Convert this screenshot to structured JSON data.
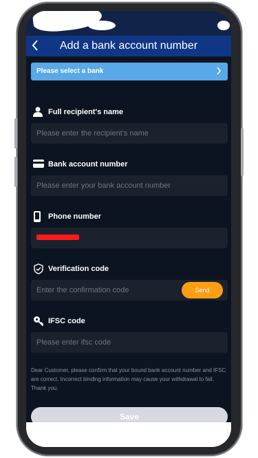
{
  "header": {
    "title": "Add a bank account number"
  },
  "bank_select": {
    "label": "Please select a bank"
  },
  "fields": {
    "name": {
      "label": "Full recipient's name",
      "placeholder": "Please enter the recipient's name"
    },
    "account": {
      "label": "Bank account number",
      "placeholder": "Please enter your bank account number"
    },
    "phone": {
      "label": "Phone number"
    },
    "verification": {
      "label": "Verification code",
      "placeholder": "Enter the confirmation code",
      "send_label": "Send"
    },
    "ifsc": {
      "label": "IFSC code",
      "placeholder": "Please enter ifsc code"
    }
  },
  "notice": "Dear Customer, please confirm that your bound bank account number and IFSC are correct. Incorrect binding information may cause your withdrawal to fail. Thank you.",
  "save_label": "Save",
  "colors": {
    "header_bg": "#103686",
    "select_bg": "#59a8e8",
    "screen_bg": "#0d1421",
    "input_bg": "#1b222e",
    "send_bg": "#ff9e12",
    "save_bg": "#d7d8e0",
    "redaction": "#ff1a1a"
  }
}
